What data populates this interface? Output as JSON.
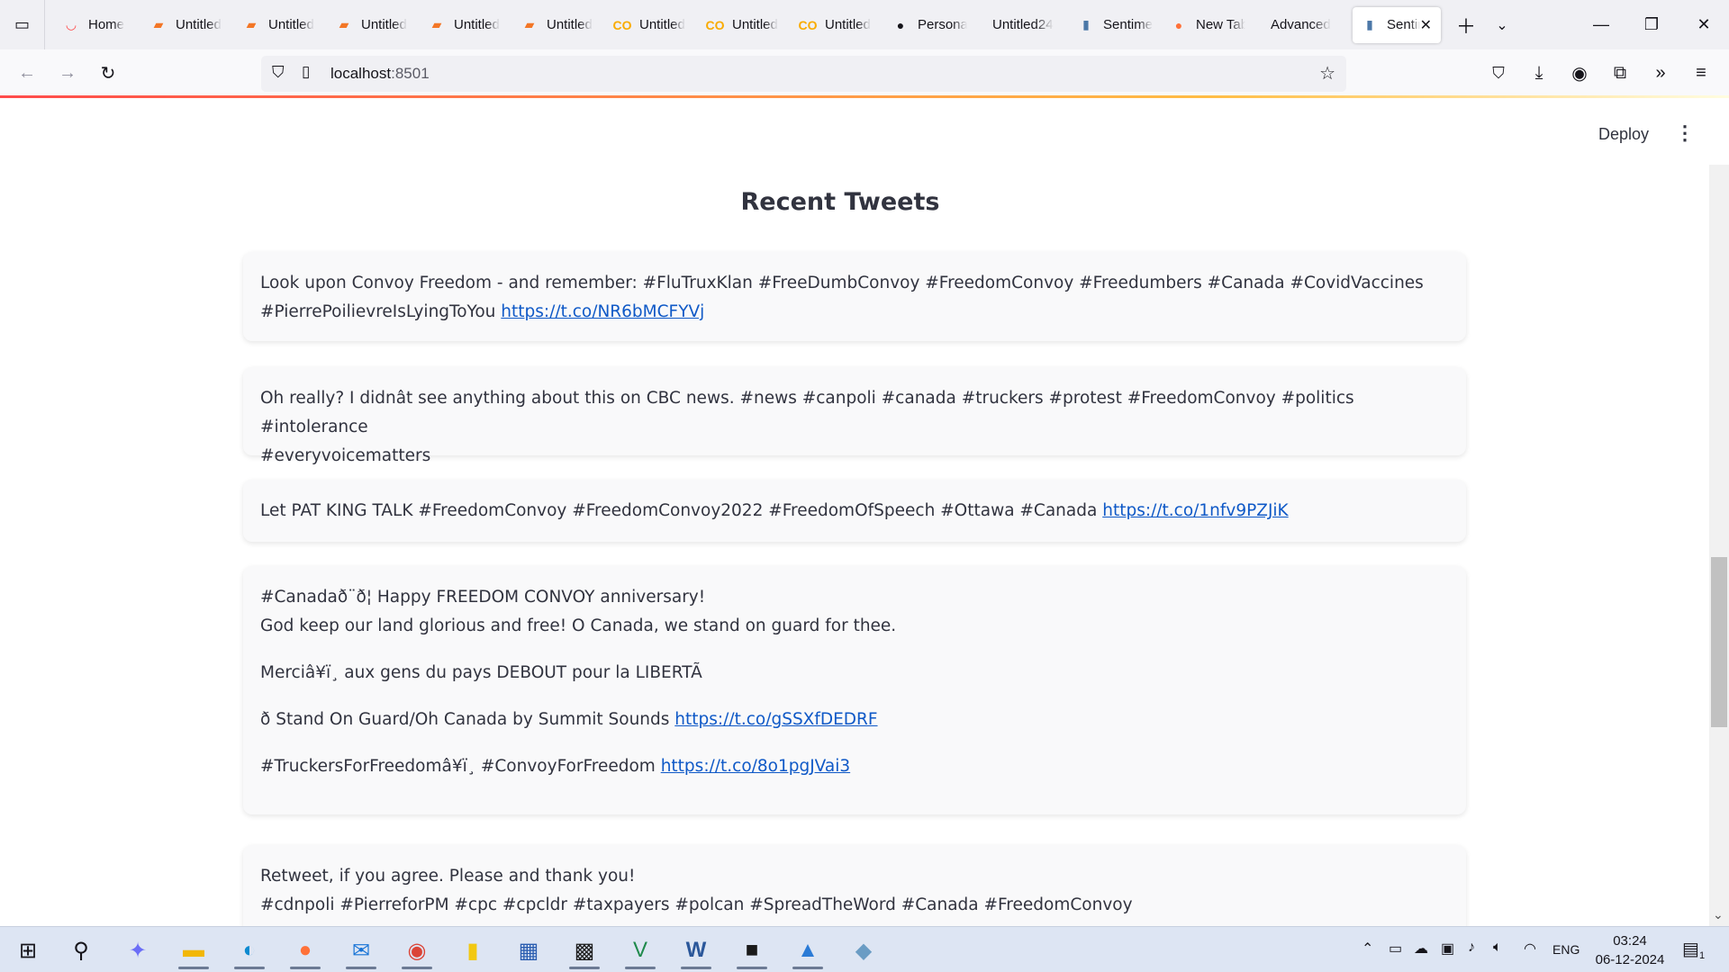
{
  "browser": {
    "tabs": [
      {
        "label": "Home",
        "icon": "streamlit-icon"
      },
      {
        "label": "Untitled",
        "icon": "notebook-icon"
      },
      {
        "label": "Untitled",
        "icon": "notebook-icon"
      },
      {
        "label": "Untitled",
        "icon": "notebook-icon"
      },
      {
        "label": "Untitled",
        "icon": "notebook-icon"
      },
      {
        "label": "Untitled",
        "icon": "notebook-icon"
      },
      {
        "label": "Untitled",
        "icon": "colab-icon"
      },
      {
        "label": "Untitled",
        "icon": "colab-icon"
      },
      {
        "label": "Untitled",
        "icon": "colab-icon"
      },
      {
        "label": "Personal",
        "icon": "github-icon"
      },
      {
        "label": "Untitled24",
        "icon": ""
      },
      {
        "label": "Sentiment",
        "icon": "chart-icon"
      },
      {
        "label": "New Tab",
        "icon": "firefox-icon"
      },
      {
        "label": "Advanced",
        "icon": ""
      }
    ],
    "active_tab": {
      "label": "Sentiment",
      "icon": "chart-icon"
    },
    "url_host": "localhost",
    "url_port": ":8501"
  },
  "page": {
    "deploy_label": "Deploy",
    "heading": "Recent Tweets",
    "tweets": [
      {
        "lines": [
          {
            "text": "Look upon Convoy Freedom - and remember: #FluTruxKlan #FreeDumbConvoy #FreedomConvoy #Freedumbers #Canada #CovidVaccines",
            "link": ""
          },
          {
            "text": "#PierrePoilievreIsLyingToYou ",
            "link": "https://t.co/NR6bMCFYVj"
          }
        ]
      },
      {
        "lines": [
          {
            "text": "Oh really? I didnât see anything about this on CBC news. #news #canpoli #canada #truckers #protest #FreedomConvoy #politics #intolerance",
            "link": ""
          },
          {
            "text": "#everyvoicematters",
            "link": ""
          }
        ]
      },
      {
        "lines": [
          {
            "text": "Let PAT KING TALK #FreedomConvoy #FreedomConvoy2022 #FreedomOfSpeech #Ottawa #Canada ",
            "link": "https://t.co/1nfv9PZJiK"
          }
        ]
      },
      {
        "lines": [
          {
            "text": "#Canadað¨ð¦ Happy FREEDOM CONVOY anniversary!",
            "link": ""
          },
          {
            "text": "God keep our land glorious and free! O Canada, we stand on guard for thee.",
            "link": ""
          },
          {
            "text": "Merciâ¥ï¸ aux gens du pays DEBOUT pour la LIBERTÃ",
            "link": ""
          },
          {
            "text": "ð Stand On Guard/Oh Canada by Summit Sounds ",
            "link": "https://t.co/gSSXfDEDRF"
          },
          {
            "text": "#TruckersForFreedomâ¥ï¸ #ConvoyForFreedom ",
            "link": "https://t.co/8o1pgJVai3"
          }
        ]
      },
      {
        "lines": [
          {
            "text": "Retweet, if you agree. Please and thank you!",
            "link": ""
          },
          {
            "text": "#cdnpoli #PierreforPM #cpc #cpcldr #taxpayers #polcan #SpreadTheWord #Canada #FreedomConvoy",
            "link": ""
          }
        ]
      }
    ]
  },
  "taskbar": {
    "apps": [
      "windows-start-icon",
      "search-icon",
      "copilot-icon",
      "file-explorer-icon",
      "edge-icon",
      "firefox-icon",
      "mail-icon",
      "chrome-icon",
      "power-bi-icon",
      "taskview-icon",
      "app-icon",
      "vs-icon",
      "word-icon",
      "terminal-icon",
      "photos-icon",
      "app2-icon"
    ],
    "language": "ENG",
    "time": "03:24",
    "date": "06-12-2024",
    "notification_count": "1"
  },
  "colors": {
    "link": "#0f59c7",
    "text": "#31333f",
    "card_bg": "#f9f9fa",
    "progress_start": "#ff4b4b",
    "progress_end": "#ffbd45"
  }
}
